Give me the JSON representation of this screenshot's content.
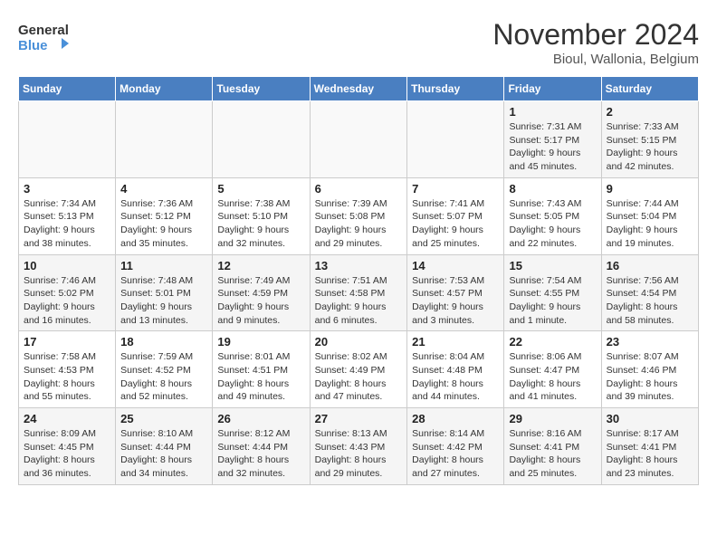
{
  "header": {
    "logo_line1": "General",
    "logo_line2": "Blue",
    "month_title": "November 2024",
    "location": "Bioul, Wallonia, Belgium"
  },
  "days_of_week": [
    "Sunday",
    "Monday",
    "Tuesday",
    "Wednesday",
    "Thursday",
    "Friday",
    "Saturday"
  ],
  "weeks": [
    [
      {
        "day": "",
        "info": ""
      },
      {
        "day": "",
        "info": ""
      },
      {
        "day": "",
        "info": ""
      },
      {
        "day": "",
        "info": ""
      },
      {
        "day": "",
        "info": ""
      },
      {
        "day": "1",
        "info": "Sunrise: 7:31 AM\nSunset: 5:17 PM\nDaylight: 9 hours\nand 45 minutes."
      },
      {
        "day": "2",
        "info": "Sunrise: 7:33 AM\nSunset: 5:15 PM\nDaylight: 9 hours\nand 42 minutes."
      }
    ],
    [
      {
        "day": "3",
        "info": "Sunrise: 7:34 AM\nSunset: 5:13 PM\nDaylight: 9 hours\nand 38 minutes."
      },
      {
        "day": "4",
        "info": "Sunrise: 7:36 AM\nSunset: 5:12 PM\nDaylight: 9 hours\nand 35 minutes."
      },
      {
        "day": "5",
        "info": "Sunrise: 7:38 AM\nSunset: 5:10 PM\nDaylight: 9 hours\nand 32 minutes."
      },
      {
        "day": "6",
        "info": "Sunrise: 7:39 AM\nSunset: 5:08 PM\nDaylight: 9 hours\nand 29 minutes."
      },
      {
        "day": "7",
        "info": "Sunrise: 7:41 AM\nSunset: 5:07 PM\nDaylight: 9 hours\nand 25 minutes."
      },
      {
        "day": "8",
        "info": "Sunrise: 7:43 AM\nSunset: 5:05 PM\nDaylight: 9 hours\nand 22 minutes."
      },
      {
        "day": "9",
        "info": "Sunrise: 7:44 AM\nSunset: 5:04 PM\nDaylight: 9 hours\nand 19 minutes."
      }
    ],
    [
      {
        "day": "10",
        "info": "Sunrise: 7:46 AM\nSunset: 5:02 PM\nDaylight: 9 hours\nand 16 minutes."
      },
      {
        "day": "11",
        "info": "Sunrise: 7:48 AM\nSunset: 5:01 PM\nDaylight: 9 hours\nand 13 minutes."
      },
      {
        "day": "12",
        "info": "Sunrise: 7:49 AM\nSunset: 4:59 PM\nDaylight: 9 hours\nand 9 minutes."
      },
      {
        "day": "13",
        "info": "Sunrise: 7:51 AM\nSunset: 4:58 PM\nDaylight: 9 hours\nand 6 minutes."
      },
      {
        "day": "14",
        "info": "Sunrise: 7:53 AM\nSunset: 4:57 PM\nDaylight: 9 hours\nand 3 minutes."
      },
      {
        "day": "15",
        "info": "Sunrise: 7:54 AM\nSunset: 4:55 PM\nDaylight: 9 hours\nand 1 minute."
      },
      {
        "day": "16",
        "info": "Sunrise: 7:56 AM\nSunset: 4:54 PM\nDaylight: 8 hours\nand 58 minutes."
      }
    ],
    [
      {
        "day": "17",
        "info": "Sunrise: 7:58 AM\nSunset: 4:53 PM\nDaylight: 8 hours\nand 55 minutes."
      },
      {
        "day": "18",
        "info": "Sunrise: 7:59 AM\nSunset: 4:52 PM\nDaylight: 8 hours\nand 52 minutes."
      },
      {
        "day": "19",
        "info": "Sunrise: 8:01 AM\nSunset: 4:51 PM\nDaylight: 8 hours\nand 49 minutes."
      },
      {
        "day": "20",
        "info": "Sunrise: 8:02 AM\nSunset: 4:49 PM\nDaylight: 8 hours\nand 47 minutes."
      },
      {
        "day": "21",
        "info": "Sunrise: 8:04 AM\nSunset: 4:48 PM\nDaylight: 8 hours\nand 44 minutes."
      },
      {
        "day": "22",
        "info": "Sunrise: 8:06 AM\nSunset: 4:47 PM\nDaylight: 8 hours\nand 41 minutes."
      },
      {
        "day": "23",
        "info": "Sunrise: 8:07 AM\nSunset: 4:46 PM\nDaylight: 8 hours\nand 39 minutes."
      }
    ],
    [
      {
        "day": "24",
        "info": "Sunrise: 8:09 AM\nSunset: 4:45 PM\nDaylight: 8 hours\nand 36 minutes."
      },
      {
        "day": "25",
        "info": "Sunrise: 8:10 AM\nSunset: 4:44 PM\nDaylight: 8 hours\nand 34 minutes."
      },
      {
        "day": "26",
        "info": "Sunrise: 8:12 AM\nSunset: 4:44 PM\nDaylight: 8 hours\nand 32 minutes."
      },
      {
        "day": "27",
        "info": "Sunrise: 8:13 AM\nSunset: 4:43 PM\nDaylight: 8 hours\nand 29 minutes."
      },
      {
        "day": "28",
        "info": "Sunrise: 8:14 AM\nSunset: 4:42 PM\nDaylight: 8 hours\nand 27 minutes."
      },
      {
        "day": "29",
        "info": "Sunrise: 8:16 AM\nSunset: 4:41 PM\nDaylight: 8 hours\nand 25 minutes."
      },
      {
        "day": "30",
        "info": "Sunrise: 8:17 AM\nSunset: 4:41 PM\nDaylight: 8 hours\nand 23 minutes."
      }
    ]
  ]
}
